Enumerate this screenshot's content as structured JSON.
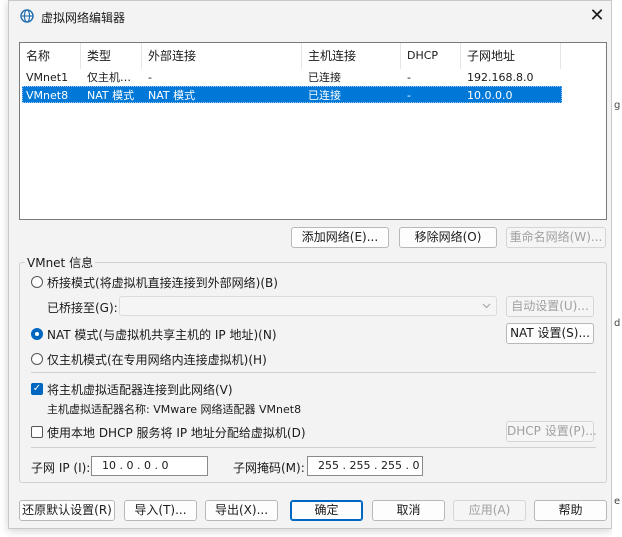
{
  "window": {
    "title": "虚拟网络编辑器",
    "close_glyph": "✕"
  },
  "table": {
    "headers": [
      "名称",
      "类型",
      "外部连接",
      "主机连接",
      "DHCP",
      "子网地址"
    ],
    "rows": [
      [
        "VMnet1",
        "仅主机…",
        "-",
        "已连接",
        "-",
        "192.168.8.0"
      ],
      [
        "VMnet8",
        "NAT 模式",
        "NAT 模式",
        "已连接",
        "-",
        "10.0.0.0"
      ]
    ],
    "selected_row": 1
  },
  "list_buttons": {
    "add": "添加网络(E)...",
    "remove": "移除网络(O)",
    "rename": "重命名网络(W)..."
  },
  "vmnet_info": {
    "group_title": "VMnet 信息",
    "bridge_mode": "桥接模式(将虚拟机直接连接到外部网络)(B)",
    "bridged_to_label": "已桥接至(G):",
    "bridged_to_value": "",
    "auto_settings": "自动设置(U)...",
    "nat_mode": "NAT 模式(与虚拟机共享主机的 IP 地址)(N)",
    "nat_settings": "NAT 设置(S)...",
    "host_only_mode": "仅主机模式(在专用网络内连接虚拟机)(H)",
    "connect_adapter": "将主机虚拟适配器连接到此网络(V)",
    "adapter_name": "主机虚拟适配器名称: VMware 网络适配器 VMnet8",
    "use_dhcp": "使用本地 DHCP 服务将 IP 地址分配给虚拟机(D)",
    "dhcp_settings": "DHCP 设置(P)...",
    "subnet_ip_label": "子网 IP (I):",
    "subnet_ip": "10 . 0 . 0 . 0",
    "subnet_mask_label": "子网掩码(M):",
    "subnet_mask": "255 . 255 . 255 . 0",
    "selected_mode": "nat",
    "connect_adapter_checked": true,
    "use_dhcp_checked": false
  },
  "footer": {
    "restore": "还原默认设置(R)",
    "import": "导入(T)...",
    "export": "导出(X)...",
    "ok": "确定",
    "cancel": "取消",
    "apply": "应用(A)",
    "help": "帮助"
  },
  "colors": {
    "selection": "#0078d7",
    "accent": "#0067c0",
    "background": "#f3f3f3"
  },
  "edge_glyphs": [
    "g",
    "d",
    "e"
  ]
}
